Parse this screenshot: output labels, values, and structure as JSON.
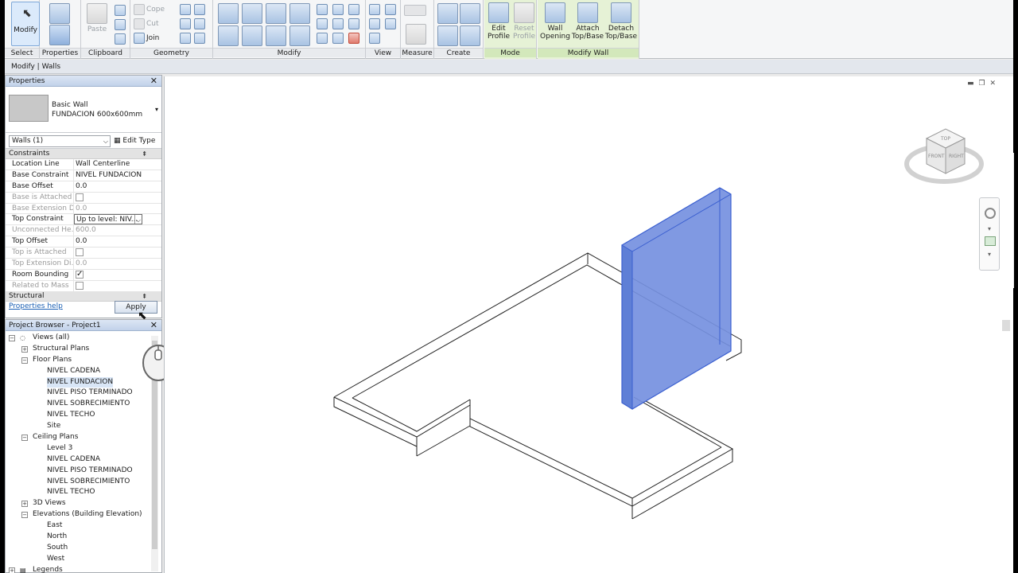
{
  "ribbon": {
    "select": {
      "modify": "Modify",
      "panel": "Select"
    },
    "properties": {
      "panel": "Properties"
    },
    "clipboard": {
      "paste": "Paste",
      "cope": "Cope",
      "cut": "Cut",
      "join": "Join",
      "panel": "Clipboard"
    },
    "geometry": {
      "panel": "Geometry"
    },
    "modify": {
      "panel": "Modify"
    },
    "view": {
      "panel": "View"
    },
    "measure": {
      "panel": "Measure"
    },
    "create": {
      "panel": "Create"
    },
    "mode": {
      "edit_profile": "Edit Profile",
      "reset_profile": "Reset Profile",
      "panel": "Mode"
    },
    "modify_wall": {
      "wall_opening": "Wall Opening",
      "attach": "Attach Top/Base",
      "detach": "Detach Top/Base",
      "panel": "Modify Wall"
    }
  },
  "context_bar": "Modify | Walls",
  "properties": {
    "title": "Properties",
    "type_family": "Basic Wall",
    "type_name": "FUNDACION 600x600mm",
    "instance_filter": "Walls (1)",
    "edit_type": "Edit Type",
    "group_constraints": "Constraints",
    "rows": [
      {
        "name": "Location Line",
        "value": "Wall Centerline",
        "dim": false
      },
      {
        "name": "Base Constraint",
        "value": "NIVEL FUNDACION",
        "dim": false
      },
      {
        "name": "Base Offset",
        "value": "0.0",
        "dim": false
      },
      {
        "name": "Base is Attached",
        "value": "",
        "dim": true
      },
      {
        "name": "Base Extension Di...",
        "value": "0.0",
        "dim": true
      },
      {
        "name": "Top Constraint",
        "value": "Up to level: NIV...",
        "dim": false
      },
      {
        "name": "Unconnected He...",
        "value": "600.0",
        "dim": true
      },
      {
        "name": "Top Offset",
        "value": "0.0",
        "dim": false
      },
      {
        "name": "Top is Attached",
        "value": "",
        "dim": true
      },
      {
        "name": "Top Extension Di...",
        "value": "0.0",
        "dim": true
      },
      {
        "name": "Room Bounding",
        "value": "",
        "dim": false
      },
      {
        "name": "Related to Mass",
        "value": "",
        "dim": true
      }
    ],
    "group_structural": "Structural",
    "help": "Properties help",
    "apply": "Apply"
  },
  "browser": {
    "title": "Project Browser - Project1",
    "nodes": [
      {
        "label": "Views (all)",
        "level": 0
      },
      {
        "label": "Structural Plans",
        "level": 1
      },
      {
        "label": "Floor Plans",
        "level": 1
      },
      {
        "label": "NIVEL CADENA",
        "level": 2
      },
      {
        "label": "NIVEL FUNDACION",
        "level": 2
      },
      {
        "label": "NIVEL PISO TERMINADO",
        "level": 2
      },
      {
        "label": "NIVEL SOBRECIMIENTO",
        "level": 2
      },
      {
        "label": "NIVEL TECHO",
        "level": 2
      },
      {
        "label": "Site",
        "level": 2
      },
      {
        "label": "Ceiling Plans",
        "level": 1
      },
      {
        "label": "Level 3",
        "level": 2
      },
      {
        "label": "NIVEL CADENA",
        "level": 2
      },
      {
        "label": "NIVEL PISO TERMINADO",
        "level": 2
      },
      {
        "label": "NIVEL SOBRECIMIENTO",
        "level": 2
      },
      {
        "label": "NIVEL TECHO",
        "level": 2
      },
      {
        "label": "3D Views",
        "level": 1
      },
      {
        "label": "Elevations (Building Elevation)",
        "level": 1
      },
      {
        "label": "East",
        "level": 2
      },
      {
        "label": "North",
        "level": 2
      },
      {
        "label": "South",
        "level": 2
      },
      {
        "label": "West",
        "level": 2
      },
      {
        "label": "Legends",
        "level": 0
      }
    ]
  },
  "viewcube": {
    "top": "TOP",
    "front": "FRONT",
    "right": "RIGHT"
  },
  "colors": {
    "accent": "#3a5fd0",
    "selection_fill": "#6f8fe0",
    "panel_green": "#e6f2d6"
  }
}
